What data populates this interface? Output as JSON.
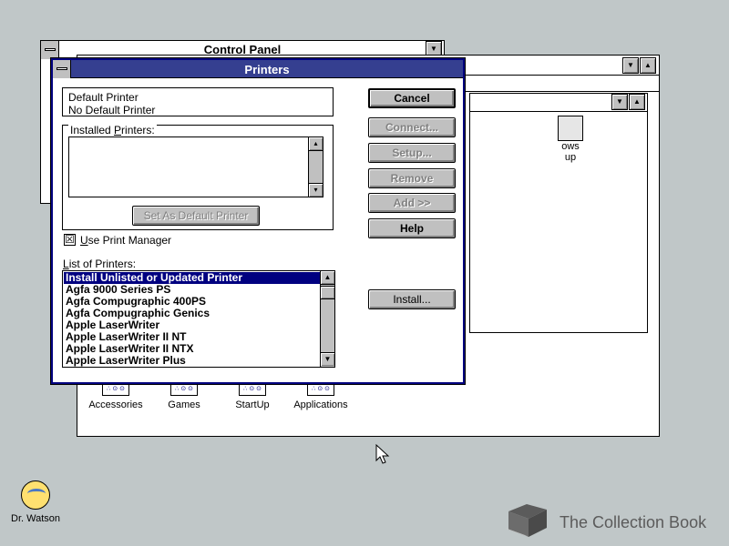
{
  "control_panel": {
    "title": "Control Panel"
  },
  "program_manager": {
    "group_icons": [
      {
        "label": "Accessories"
      },
      {
        "label": "Games"
      },
      {
        "label": "StartUp"
      },
      {
        "label": "Applications"
      }
    ],
    "icon_caption": "∴ ⊙ ⊙",
    "partial_group_icon_label_1": "ows",
    "partial_group_icon_label_2": "up"
  },
  "printers_dialog": {
    "title": "Printers",
    "default_printer": {
      "group_label": "Default Printer",
      "value": "No Default Printer"
    },
    "installed_printers": {
      "group_label_pre": "Installed ",
      "group_label_underline": "P",
      "group_label_post": "rinters:",
      "items": []
    },
    "set_default_button": "Set As Default Printer",
    "use_print_manager": {
      "label_pre": "",
      "label_underline": "U",
      "label_post": "se Print Manager",
      "checked": true,
      "mark": "☒"
    },
    "list_of_printers": {
      "label_pre": "",
      "label_underline": "L",
      "label_post": "ist of Printers:",
      "items": [
        "Install Unlisted or Updated Printer",
        "Agfa 9000 Series PS",
        "Agfa Compugraphic 400PS",
        "Agfa Compugraphic Genics",
        "Apple LaserWriter",
        "Apple LaserWriter II NT",
        "Apple LaserWriter II NTX",
        "Apple LaserWriter Plus"
      ],
      "selected_index": 0
    },
    "buttons": {
      "cancel": "Cancel",
      "connect": "Connect...",
      "setup": "Setup...",
      "remove": "Remove",
      "add": "Add >>",
      "help": "Help",
      "install": "Install..."
    }
  },
  "desktop": {
    "dr_watson_label": "Dr. Watson",
    "watermark_text": "The Collection Book"
  },
  "scroll_glyphs": {
    "up": "▲",
    "down": "▼",
    "small_up": "▴",
    "small_down": "▾"
  },
  "colors": {
    "desktop": "#c0c7c8",
    "title_active": "#353f90",
    "selection": "#000080"
  }
}
